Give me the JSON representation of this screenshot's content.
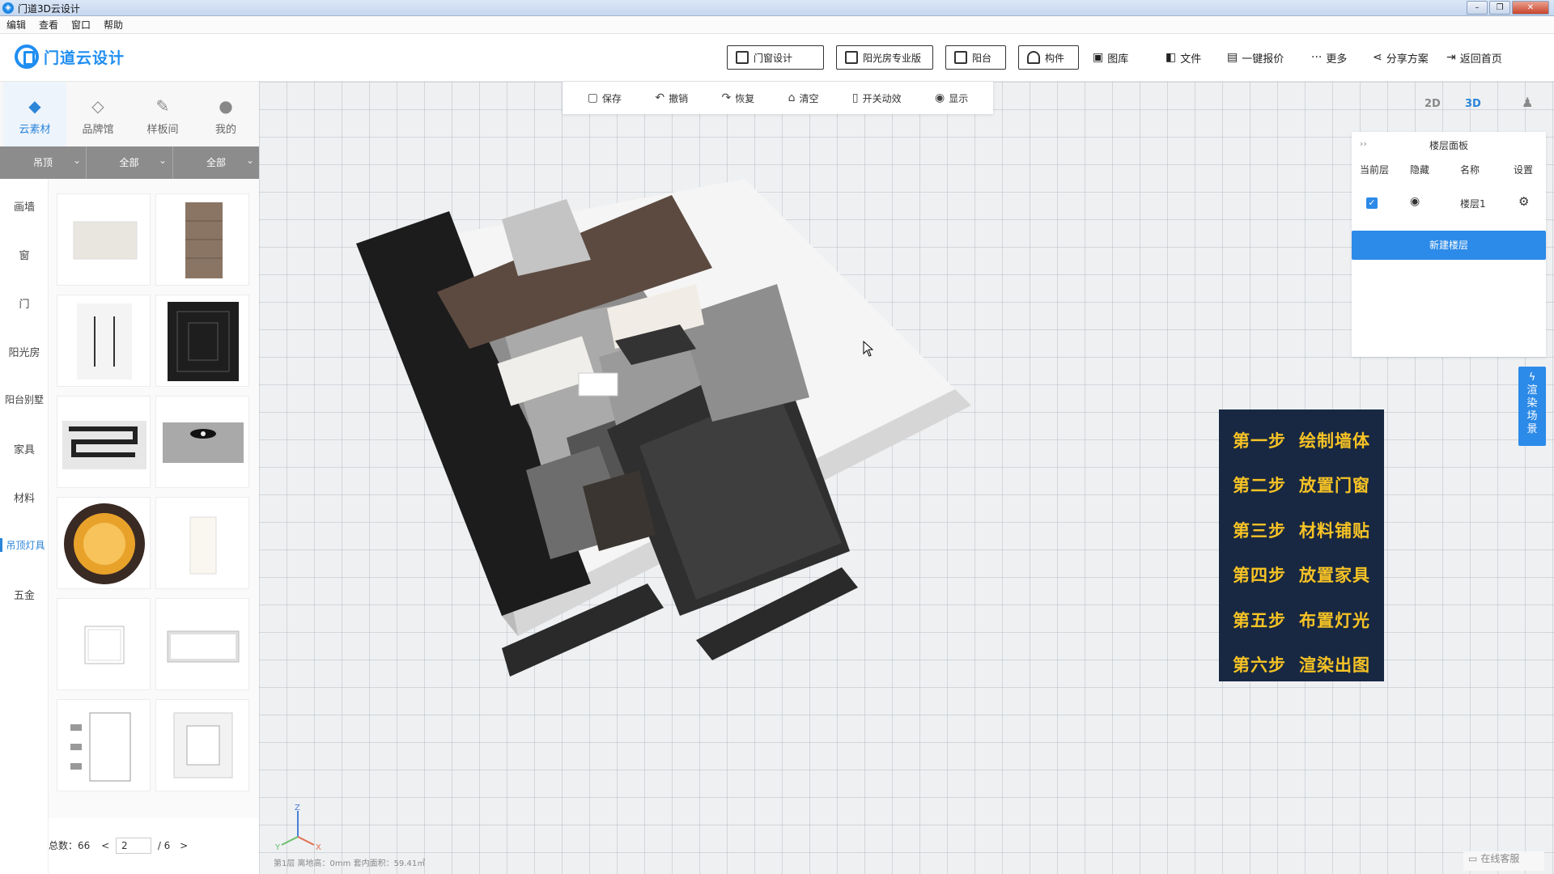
{
  "window": {
    "title": "门道3D云设计",
    "controls": [
      "–",
      "❐",
      "✕"
    ]
  },
  "menu": [
    "编辑",
    "查看",
    "窗口",
    "帮助"
  ],
  "header": {
    "logo_text": "门道云设计",
    "buttons": [
      {
        "label": "门窗设计",
        "icon": "window-icon"
      },
      {
        "label": "阳光房专业版",
        "icon": "sunroom-icon"
      },
      {
        "label": "阳台",
        "icon": "balcony-icon"
      },
      {
        "label": "构件",
        "icon": "component-icon"
      }
    ],
    "links": [
      {
        "label": "图库",
        "icon": "image-icon",
        "glyph": "▣"
      },
      {
        "label": "文件",
        "icon": "file-icon",
        "glyph": "◧"
      },
      {
        "label": "一键报价",
        "icon": "quote-icon",
        "glyph": "▤"
      },
      {
        "label": "更多",
        "icon": "more-icon",
        "glyph": "···"
      },
      {
        "label": "分享方案",
        "icon": "share-icon",
        "glyph": "⋖"
      },
      {
        "label": "返回首页",
        "icon": "exit-icon",
        "glyph": "⇥"
      }
    ]
  },
  "sidebar": {
    "tabs": [
      {
        "label": "云素材",
        "icon": "cube-icon",
        "glyph": "◆"
      },
      {
        "label": "品牌馆",
        "icon": "diamond-icon",
        "glyph": "◇"
      },
      {
        "label": "样板间",
        "icon": "brush-icon",
        "glyph": "✎"
      },
      {
        "label": "我的",
        "icon": "user-icon",
        "glyph": "●"
      }
    ],
    "collapse": "‹‹",
    "filters": [
      "吊顶",
      "全部",
      "全部"
    ],
    "categories": [
      "画墙",
      "窗",
      "门",
      "阳光房",
      "阳台别墅",
      "家具",
      "材料",
      "吊顶灯具",
      "五金"
    ],
    "pager": {
      "total_label": "总数：66",
      "prev": "<",
      "page": "2",
      "pages": "/ 6",
      "next": ">"
    }
  },
  "toolbar": [
    {
      "label": "保存",
      "icon": "save-icon",
      "glyph": "▢"
    },
    {
      "label": "撤销",
      "icon": "undo-icon",
      "glyph": "↶"
    },
    {
      "label": "恢复",
      "icon": "redo-icon",
      "glyph": "↷"
    },
    {
      "label": "清空",
      "icon": "clear-icon",
      "glyph": "⌂"
    },
    {
      "label": "开关动效",
      "icon": "animation-icon",
      "glyph": "▯"
    },
    {
      "label": "显示",
      "icon": "eye-icon",
      "glyph": "◉"
    }
  ],
  "viewmodes": [
    "2D",
    "3D"
  ],
  "floor_panel": {
    "title": "楼层面板",
    "headers": [
      "当前层",
      "隐藏",
      "名称",
      "设置"
    ],
    "row": {
      "name": "楼层1"
    },
    "new_button": "新建楼层"
  },
  "render_button": "渲染场景",
  "steps": [
    {
      "num": "第一步",
      "text": "绘制墙体"
    },
    {
      "num": "第二步",
      "text": "放置门窗"
    },
    {
      "num": "第三步",
      "text": "材料铺贴"
    },
    {
      "num": "第四步",
      "text": "放置家具"
    },
    {
      "num": "第五步",
      "text": "布置灯光"
    },
    {
      "num": "第六步",
      "text": "渲染出图"
    }
  ],
  "status": "第1层  离地高：0mm  套内面积：59.41㎡",
  "customer_service": "在线客服",
  "colors": {
    "accent": "#2c8ae8",
    "steps_bg": "#182842",
    "steps_text": "#f7c325"
  }
}
